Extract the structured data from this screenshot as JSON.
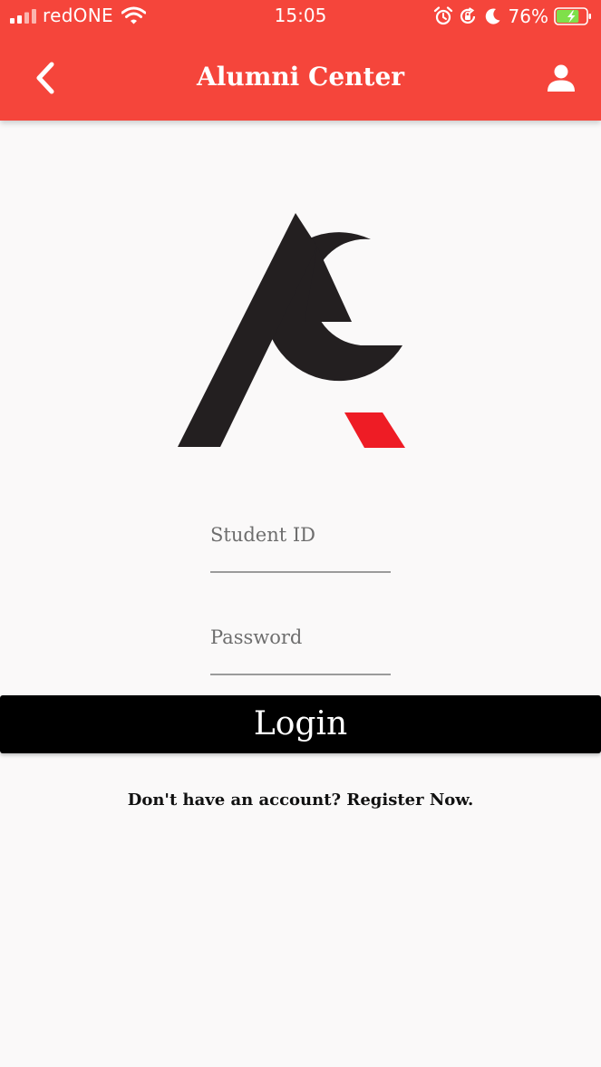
{
  "status_bar": {
    "carrier": "redONE",
    "time": "15:05",
    "battery_percent": "76%",
    "battery_level": 0.76
  },
  "header": {
    "title": "Alumni Center",
    "back_icon": "chevron-left-icon",
    "profile_icon": "user-icon",
    "background_color": "#f5453b"
  },
  "logo": {
    "name": "ac-logo",
    "primary_color": "#231f20",
    "accent_color": "#ee1c25"
  },
  "form": {
    "student_id_placeholder": "Student ID",
    "student_id_value": "",
    "password_placeholder": "Password",
    "password_value": "",
    "login_label": "Login"
  },
  "footer": {
    "register_text": "Don't have an account? Register Now."
  }
}
